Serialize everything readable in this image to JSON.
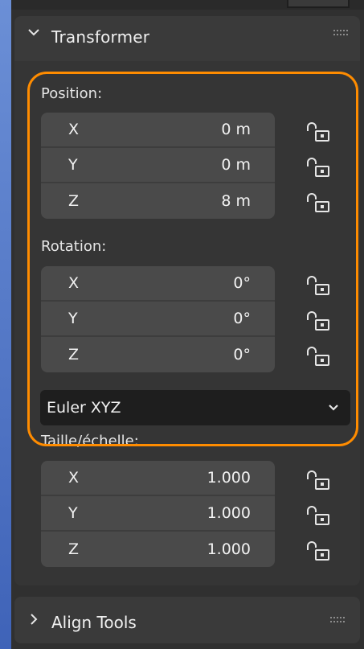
{
  "panel": {
    "title": "Transformer",
    "collapsed": false,
    "highlight_color": "#ff8c00"
  },
  "position": {
    "label": "Position:",
    "fields": [
      {
        "axis": "X",
        "value": "0 m",
        "locked": false
      },
      {
        "axis": "Y",
        "value": "0 m",
        "locked": false
      },
      {
        "axis": "Z",
        "value": "8 m",
        "locked": false
      }
    ]
  },
  "rotation": {
    "label": "Rotation:",
    "fields": [
      {
        "axis": "X",
        "value": "0°",
        "locked": false
      },
      {
        "axis": "Y",
        "value": "0°",
        "locked": false
      },
      {
        "axis": "Z",
        "value": "0°",
        "locked": false
      }
    ],
    "mode": "Euler XYZ"
  },
  "scale": {
    "label": "Taille/échelle:",
    "fields": [
      {
        "axis": "X",
        "value": "1.000",
        "locked": false
      },
      {
        "axis": "Y",
        "value": "1.000",
        "locked": false
      },
      {
        "axis": "Z",
        "value": "1.000",
        "locked": false
      }
    ]
  },
  "align_panel": {
    "title": "Align Tools",
    "collapsed": true
  },
  "icons": {
    "expand": "chevron-down-icon",
    "collapse": "chevron-right-icon",
    "lock": "unlocked-padlock-icon",
    "grip": "drag-grip-icon",
    "dropdown": "chevron-down-icon"
  }
}
